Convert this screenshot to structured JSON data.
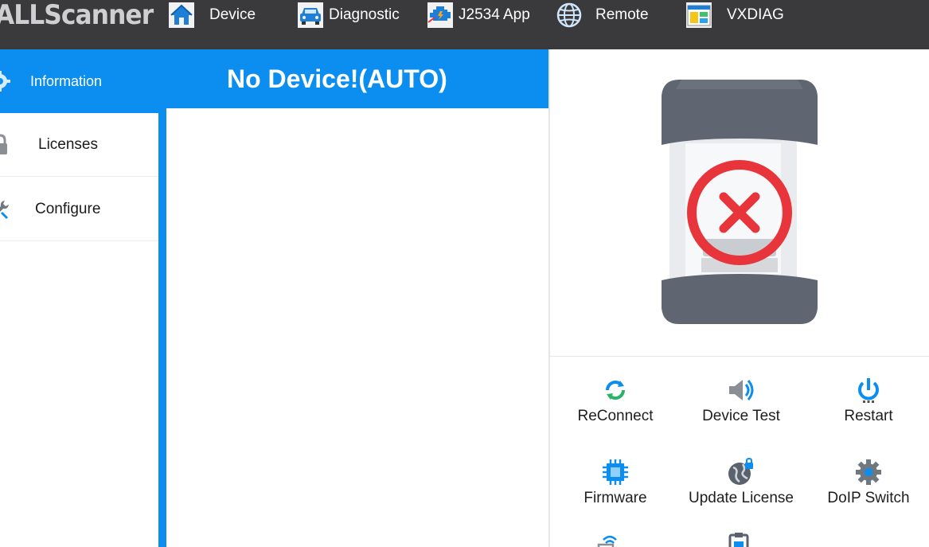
{
  "app": {
    "brand": "ALLScanner"
  },
  "nav": [
    {
      "label": "Device",
      "icon": "home-icon"
    },
    {
      "label": "Diagnostic",
      "icon": "car-icon"
    },
    {
      "label": "J2534 App",
      "icon": "engine-icon"
    },
    {
      "label": "Remote",
      "icon": "globe-icon"
    },
    {
      "label": "VXDIAG",
      "icon": "window-icon"
    }
  ],
  "sidebar": {
    "items": [
      {
        "label": "Information",
        "icon": "gear-icon",
        "active": true
      },
      {
        "label": "Licenses",
        "icon": "lock-icon",
        "active": false
      },
      {
        "label": "Configure",
        "icon": "wrench-icon",
        "active": false
      }
    ]
  },
  "main": {
    "title": "No Device!(AUTO)"
  },
  "device": {
    "status": "disconnected",
    "status_icon": "error-x-icon"
  },
  "actions": [
    {
      "label": "ReConnect",
      "icon": "reconnect-icon"
    },
    {
      "label": "Device Test",
      "icon": "speaker-icon"
    },
    {
      "label": "Restart",
      "icon": "power-icon"
    },
    {
      "label": "Firmware",
      "icon": "chip-icon"
    },
    {
      "label": "Update License",
      "icon": "globe-lock-icon"
    },
    {
      "label": "DoIP Switch",
      "icon": "gear-icon"
    }
  ],
  "colors": {
    "topbar": "#3a3a3c",
    "accent": "#0b8ef0",
    "error": "#e8343b"
  }
}
